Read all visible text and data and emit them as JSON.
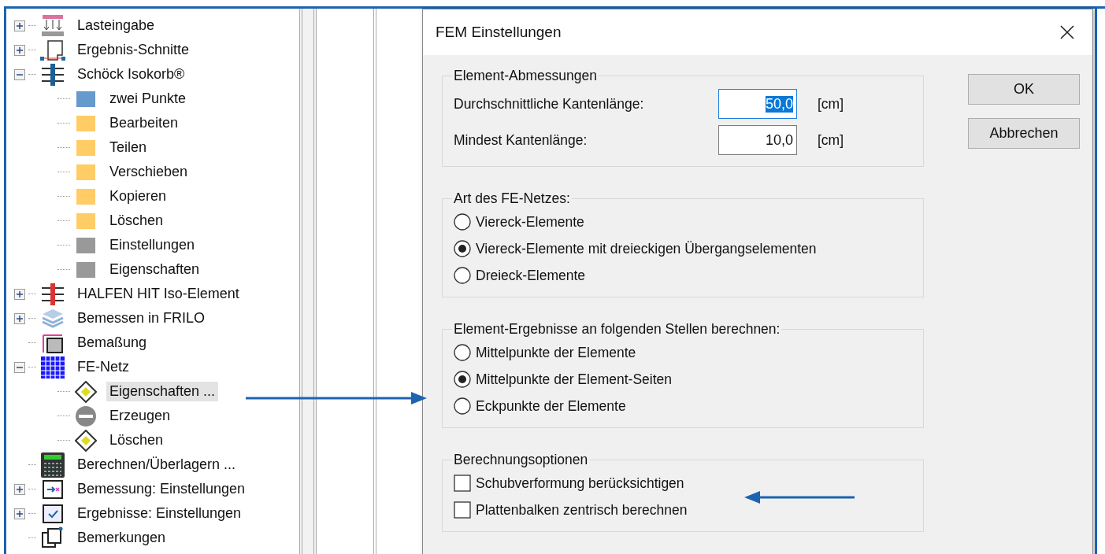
{
  "tree": [
    {
      "label": "Lasteingabe",
      "kind": "load",
      "expanded": false,
      "selected": false
    },
    {
      "label": "Ergebnis-Schnitte",
      "kind": "section",
      "expanded": false,
      "selected": false
    },
    {
      "label": "Schöck Isokorb®",
      "kind": "isokorb",
      "expanded": true,
      "selected": false,
      "children": [
        {
          "label": "zwei Punkte",
          "kind": "square",
          "color": "#6699cc",
          "selected": false
        },
        {
          "label": "Bearbeiten",
          "kind": "square",
          "color": "#ffcc66",
          "selected": false
        },
        {
          "label": "Teilen",
          "kind": "square",
          "color": "#ffcc66",
          "selected": false
        },
        {
          "label": "Verschieben",
          "kind": "square",
          "color": "#ffcc66",
          "selected": false
        },
        {
          "label": "Kopieren",
          "kind": "square",
          "color": "#ffcc66",
          "selected": false
        },
        {
          "label": "Löschen",
          "kind": "square",
          "color": "#ffcc66",
          "selected": false
        },
        {
          "label": "Einstellungen",
          "kind": "square",
          "color": "#999999",
          "selected": false
        },
        {
          "label": "Eigenschaften",
          "kind": "square",
          "color": "#999999",
          "selected": false
        }
      ]
    },
    {
      "label": "HALFEN HIT Iso-Element",
      "kind": "halfen",
      "expanded": false,
      "selected": false
    },
    {
      "label": "Bemessen in FRILO",
      "kind": "stack",
      "expanded": false,
      "selected": false
    },
    {
      "label": "Bemaßung",
      "kind": "dimension",
      "selected": false
    },
    {
      "label": "FE-Netz",
      "kind": "mesh",
      "expanded": true,
      "selected": false,
      "children": [
        {
          "label": "Eigenschaften ...",
          "kind": "diamond",
          "selected": true
        },
        {
          "label": "Erzeugen",
          "kind": "minus-circle",
          "selected": false
        },
        {
          "label": "Löschen",
          "kind": "diamond",
          "selected": false
        }
      ]
    },
    {
      "label": "Berechnen/Überlagern ...",
      "kind": "calculator",
      "selected": false
    },
    {
      "label": "Bemessung: Einstellungen",
      "kind": "design",
      "expanded": false,
      "selected": false
    },
    {
      "label": "Ergebnisse: Einstellungen",
      "kind": "results",
      "expanded": false,
      "selected": false
    },
    {
      "label": "Bemerkungen",
      "kind": "notes",
      "selected": false
    }
  ],
  "dialog": {
    "title": "FEM Einstellungen",
    "groups": [
      {
        "title": "Element-Abmessungen",
        "kind": "fields",
        "items": [
          {
            "label": "Durchschnittliche Kantenlänge:",
            "value": "50,0",
            "unit": "[cm]",
            "focused": true
          },
          {
            "label": "Mindest Kantenlänge:",
            "value": "10,0",
            "unit": "[cm]",
            "focused": false
          }
        ]
      },
      {
        "title": "Art des FE-Netzes:",
        "kind": "radios",
        "items": [
          {
            "label": "Viereck-Elemente",
            "selected": false
          },
          {
            "label": "Viereck-Elemente mit dreieckigen Übergangselementen",
            "selected": true
          },
          {
            "label": "Dreieck-Elemente",
            "selected": false
          }
        ]
      },
      {
        "title": "Element-Ergebnisse an folgenden Stellen berechnen:",
        "kind": "radios",
        "items": [
          {
            "label": "Mittelpunkte der Elemente",
            "selected": false
          },
          {
            "label": "Mittelpunkte der Element-Seiten",
            "selected": true
          },
          {
            "label": "Eckpunkte der Elemente",
            "selected": false
          }
        ]
      },
      {
        "title": "Berechnungsoptionen",
        "kind": "checks",
        "items": [
          {
            "label": "Schubverformung berücksichtigen",
            "checked": false
          },
          {
            "label": "Plattenbalken zentrisch berechnen",
            "checked": false
          }
        ]
      }
    ],
    "buttons": [
      "OK",
      "Abbrechen"
    ]
  }
}
